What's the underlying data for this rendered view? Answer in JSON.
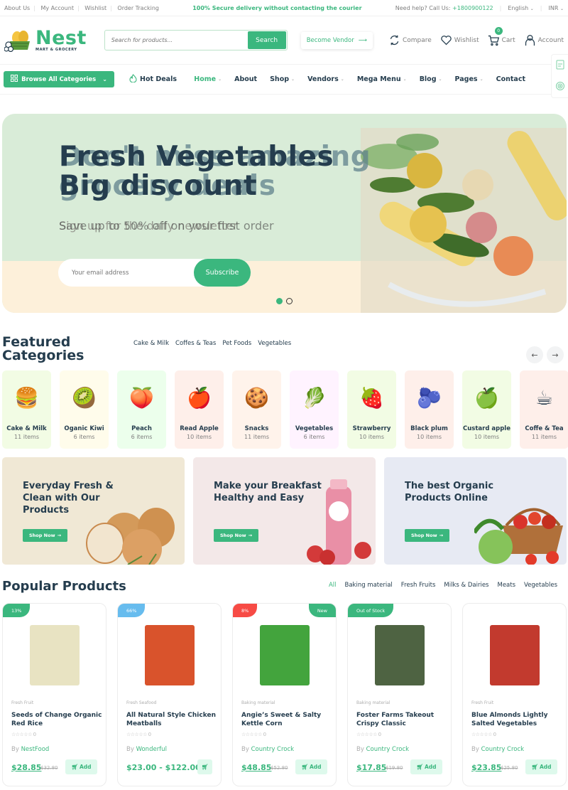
{
  "topbar": {
    "links": [
      "About Us",
      "My Account",
      "Wishlist",
      "Order Tracking"
    ],
    "promo": "100% Secure delivery without contacting the courier",
    "help_prefix": "Need help? Call Us: ",
    "phone": "+1800900122",
    "language": "English",
    "currency": "INR"
  },
  "header": {
    "logo_name": "Nest",
    "logo_tagline": "MART & GROCERY",
    "search_placeholder": "Search for products...",
    "search_button": "Search",
    "become_vendor": "Become Vendor",
    "compare": "Compare",
    "wishlist": "Wishlist",
    "cart": "Cart",
    "cart_count": "0",
    "account": "Account"
  },
  "nav": {
    "browse": "Browse All Categories",
    "hot_deals": "Hot Deals",
    "menu": [
      {
        "label": "Home",
        "dropdown": true,
        "active": true
      },
      {
        "label": "About",
        "dropdown": false
      },
      {
        "label": "Shop",
        "dropdown": true
      },
      {
        "label": "Vendors",
        "dropdown": true
      },
      {
        "label": "Mega Menu",
        "dropdown": true
      },
      {
        "label": "Blog",
        "dropdown": true
      },
      {
        "label": "Pages",
        "dropdown": true
      },
      {
        "label": "Contact",
        "dropdown": false
      }
    ]
  },
  "hero": {
    "slide1_title_line1": "Fresh Vegetables",
    "slide1_title_line2": "Big discount",
    "slide1_subtitle": "Save up to 50% off on your first order",
    "slide2_title_line1": "Don't miss amazing",
    "slide2_title_line2": "grocery deals",
    "slide2_subtitle": "Sign up for the daily newsletter",
    "email_placeholder": "Your email address",
    "subscribe": "Subscribe",
    "active_slide": 1,
    "slide_count": 2
  },
  "featured": {
    "title_line1": "Featured",
    "title_line2": "Categories",
    "tabs": [
      "Cake & Milk",
      "Coffes & Teas",
      "Pet Foods",
      "Vegetables"
    ],
    "categories": [
      {
        "name": "Cake & Milk",
        "count": "11 items",
        "bg": "#f2fce4",
        "icon": "🍔"
      },
      {
        "name": "Oganic Kiwi",
        "count": "6 items",
        "bg": "#fffceb",
        "icon": "🥝"
      },
      {
        "name": "Peach",
        "count": "6 items",
        "bg": "#ecffec",
        "icon": "🍑"
      },
      {
        "name": "Read Apple",
        "count": "10 items",
        "bg": "#feefea",
        "icon": "🍎"
      },
      {
        "name": "Snacks",
        "count": "11 items",
        "bg": "#fff3eb",
        "icon": "🍪"
      },
      {
        "name": "Vegetables",
        "count": "6 items",
        "bg": "#fff3ff",
        "icon": "🥬"
      },
      {
        "name": "Strawberry",
        "count": "10 items",
        "bg": "#f2fce4",
        "icon": "🍓"
      },
      {
        "name": "Black plum",
        "count": "10 items",
        "bg": "#feefea",
        "icon": "🫐"
      },
      {
        "name": "Custard apple",
        "count": "10 items",
        "bg": "#f2fce4",
        "icon": "🍏"
      },
      {
        "name": "Coffe & Tea",
        "count": "11 items",
        "bg": "#feefea",
        "icon": "☕"
      }
    ]
  },
  "banners": [
    {
      "title": "Everyday Fresh & Clean with Our Products",
      "button": "Shop Now",
      "bg": "#f0e8d5"
    },
    {
      "title": "Make your Breakfast Healthy and Easy",
      "button": "Shop Now",
      "bg": "#f3e8e8"
    },
    {
      "title": "The best Organic Products Online",
      "button": "Shop Now",
      "bg": "#e7eaf3"
    }
  ],
  "popular": {
    "title": "Popular Products",
    "tabs": [
      "All",
      "Baking material",
      "Fresh Fruits",
      "Milks & Dairies",
      "Meats",
      "Vegetables"
    ],
    "active_tab": "All",
    "products": [
      {
        "badge": "13%",
        "badge_color": "#3bb77e",
        "badge2": "",
        "category": "Fresh Fruit",
        "title": "Seeds of Change Organic Red Rice",
        "rating_count": "0",
        "vendor_prefix": "By ",
        "vendor": "NestFood",
        "price": "$28.85",
        "old_price": "$32.80",
        "add": "Add",
        "img_color": "#e8e3c2"
      },
      {
        "badge": "66%",
        "badge_color": "#67bcee",
        "badge2": "",
        "category": "Fresh Seafood",
        "title": "All Natural Style Chicken Meatballs",
        "rating_count": "0",
        "vendor_prefix": "By ",
        "vendor": "Wonderful",
        "price": "$23.00 - $122.00",
        "old_price": "",
        "add": "",
        "img_color": "#d9532c"
      },
      {
        "badge": "8%",
        "badge_color": "#f74b45",
        "badge2": "New",
        "category": "Baking material",
        "title": "Angie’s Sweet & Salty Kettle Corn",
        "rating_count": "0",
        "vendor_prefix": "By ",
        "vendor": "Country Crock",
        "price": "$48.85",
        "old_price": "$52.80",
        "add": "Add",
        "img_color": "#43a43d"
      },
      {
        "badge": "Out of Stock",
        "badge_color": "#3bb77e",
        "badge2": "",
        "category": "Baking material",
        "title": "Foster Farms Takeout Crispy Classic",
        "rating_count": "0",
        "vendor_prefix": "By ",
        "vendor": "Country Crock",
        "price": "$17.85",
        "old_price": "$19.80",
        "add": "Add",
        "img_color": "#4e6342"
      },
      {
        "badge": "",
        "badge_color": "",
        "badge2": "",
        "category": "Fresh Fruit",
        "title": "Blue Almonds Lightly Salted Vegetables",
        "rating_count": "0",
        "vendor_prefix": "By ",
        "vendor": "Country Crock",
        "price": "$23.85",
        "old_price": "$25.80",
        "add": "Add",
        "img_color": "#c23a2e"
      }
    ]
  },
  "colors": {
    "brand": "#3bb77e",
    "heading": "#253d4e",
    "muted": "#7e7e7e"
  }
}
